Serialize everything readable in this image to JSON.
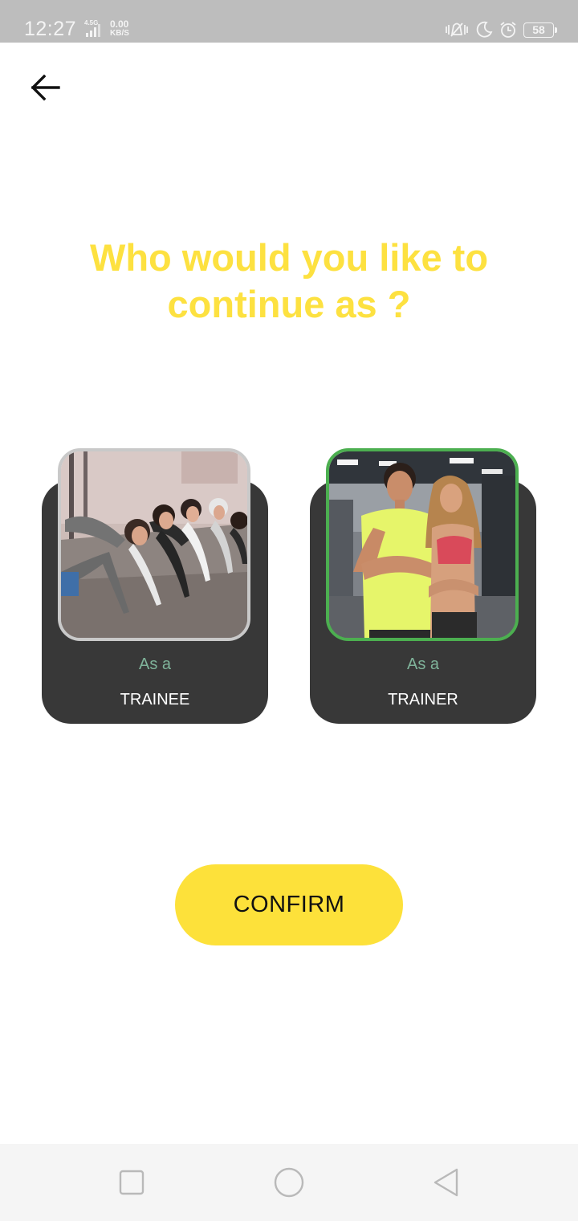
{
  "status_bar": {
    "time": "12:27",
    "network_type": "4.5G",
    "speed_value": "0.00",
    "speed_unit": "KB/S",
    "battery": "58",
    "icons": [
      "signal-icon",
      "vibrate-icon",
      "do-not-disturb-moon-icon",
      "alarm-icon",
      "battery-icon"
    ]
  },
  "header": {
    "back_icon": "arrow-left-icon"
  },
  "title": {
    "line1": "Who would you like to",
    "line2": "continue as ?"
  },
  "roles": [
    {
      "subtitle": "As a",
      "label": "TRAINEE",
      "selected": false,
      "image": "group-side-plank-photo"
    },
    {
      "subtitle": "As a",
      "label": "TRAINER",
      "selected": true,
      "image": "trainer-couple-photo"
    }
  ],
  "confirm": {
    "label": "CONFIRM"
  },
  "nav_bar": {
    "icons": [
      "recent-apps-square-icon",
      "home-circle-icon",
      "back-triangle-icon"
    ]
  },
  "colors": {
    "accent_yellow": "#fde13a",
    "title_yellow": "#fde140",
    "card_bg": "#383838",
    "selected_border": "#4caf50",
    "unselected_border": "#c9c9c9",
    "subtitle_green": "#7fb39a",
    "status_bar_bg": "#bdbdbd",
    "nav_bar_bg": "#f5f5f5"
  }
}
